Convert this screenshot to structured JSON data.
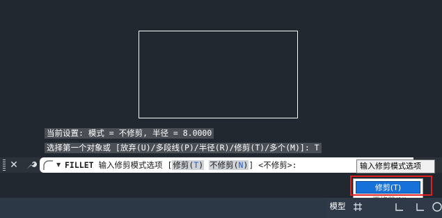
{
  "history": {
    "line1": "当前设置: 模式 = 不修剪, 半径 = 8.0000",
    "line2": "选择第一个对象或 [放弃(U)/多段线(P)/半径(R)/修剪(T)/多个(M)]: T"
  },
  "command": {
    "name": "FILLET",
    "prompt": "输入修剪模式选项",
    "open_bracket": "[",
    "opt1_label": "修剪(",
    "opt1_key": "T",
    "opt1_close": ")",
    "opt2_label": "不修剪(",
    "opt2_key": "N",
    "opt2_close": ")",
    "close_bracket": "]",
    "default": "<不修剪>:"
  },
  "tooltip": {
    "text": "输入修剪模式选项"
  },
  "menu": {
    "items": [
      {
        "label": "修剪(T)",
        "selected": true
      },
      {
        "label": "不修剪(N)",
        "bullet": "•"
      }
    ]
  },
  "status": {
    "model_tab": "模型"
  },
  "colors": {
    "background": "#212830",
    "highlight": "#1672d9",
    "callout": "#e02020"
  },
  "icons": [
    "close-icon",
    "wrench-icon",
    "fillet-arc-icon",
    "chevron-down-icon",
    "grid-icon",
    "snap-icon",
    "ortho-icon"
  ]
}
